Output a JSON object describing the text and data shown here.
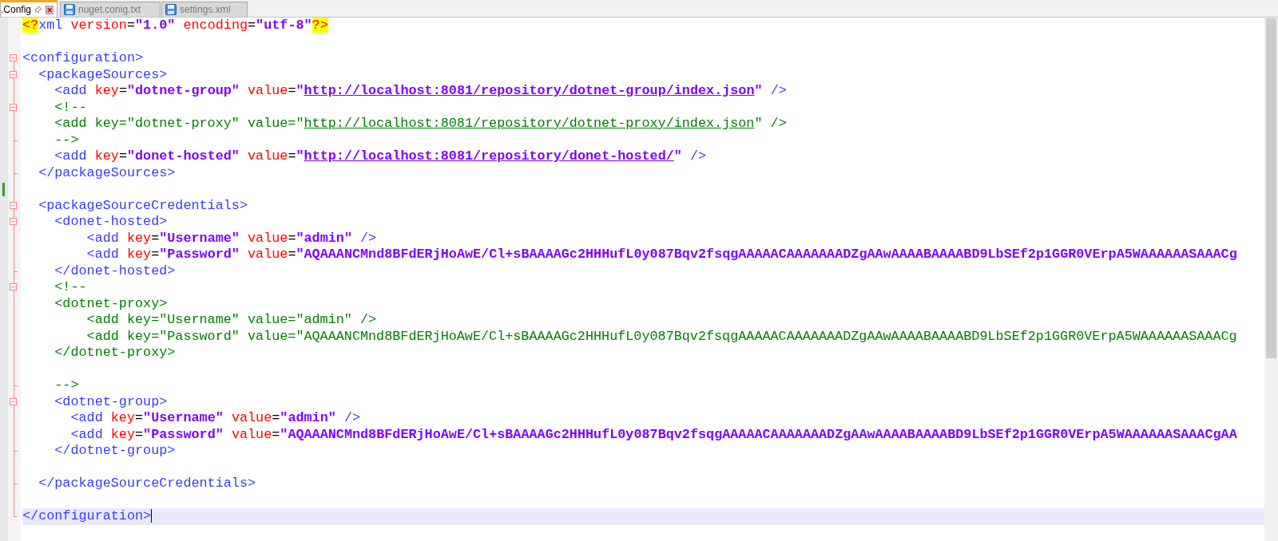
{
  "tabs": [
    {
      "label": ".Config",
      "selected": true
    },
    {
      "label": "nuget.conig.txt",
      "selected": false
    },
    {
      "label": "settings.xml",
      "selected": false
    }
  ],
  "lines": [
    {
      "kind": "none",
      "changed": false,
      "current": false,
      "tokens": [
        {
          "kind": "pi",
          "text": "<?"
        },
        {
          "kind": "tag",
          "text": "xml"
        },
        {
          "kind": "attr",
          "text": " version"
        },
        {
          "kind": "eq",
          "text": "="
        },
        {
          "kind": "str",
          "text": "\"1.0\""
        },
        {
          "kind": "attr",
          "text": " encoding"
        },
        {
          "kind": "eq",
          "text": "="
        },
        {
          "kind": "str",
          "text": "\"utf-8\""
        },
        {
          "kind": "pi",
          "text": "?>"
        }
      ]
    },
    {
      "kind": "none",
      "changed": false,
      "current": false
    },
    {
      "kind": "open",
      "changed": false,
      "current": false,
      "tokens": [
        {
          "kind": "tag",
          "text": "<configuration>"
        }
      ]
    },
    {
      "kind": "open",
      "changed": false,
      "current": false,
      "tokens": [
        {
          "kind": "tag",
          "text": "  <packageSources>"
        }
      ]
    },
    {
      "kind": "mid",
      "changed": false,
      "current": false,
      "tokens": [
        {
          "kind": "tag",
          "text": "    <add"
        },
        {
          "kind": "attr",
          "text": " key"
        },
        {
          "kind": "eq",
          "text": "="
        },
        {
          "kind": "str",
          "text": "\"dotnet-group\""
        },
        {
          "kind": "attr",
          "text": " value"
        },
        {
          "kind": "eq",
          "text": "="
        },
        {
          "kind": "str",
          "text": "\""
        },
        {
          "kind": "link",
          "text": "http://localhost:8081/repository/dotnet-group/index.json"
        },
        {
          "kind": "str",
          "text": "\""
        },
        {
          "kind": "tag",
          "text": " />"
        }
      ]
    },
    {
      "kind": "open",
      "changed": false,
      "current": false,
      "tokens": [
        {
          "kind": "comment",
          "text": "    <!--"
        }
      ]
    },
    {
      "kind": "mid",
      "changed": false,
      "current": false,
      "tokens": [
        {
          "kind": "comment",
          "text": "    <add key=\"dotnet-proxy\" value=\""
        },
        {
          "kind": "comment-link",
          "text": "http://localhost:8081/repository/dotnet-proxy/index.json"
        },
        {
          "kind": "comment",
          "text": "\" />"
        }
      ]
    },
    {
      "kind": "end",
      "changed": false,
      "current": false,
      "tokens": [
        {
          "kind": "comment",
          "text": "    -->"
        }
      ]
    },
    {
      "kind": "mid",
      "changed": false,
      "current": false,
      "tokens": [
        {
          "kind": "tag",
          "text": "    <add"
        },
        {
          "kind": "attr",
          "text": " key"
        },
        {
          "kind": "eq",
          "text": "="
        },
        {
          "kind": "str",
          "text": "\"donet-hosted\""
        },
        {
          "kind": "attr",
          "text": " value"
        },
        {
          "kind": "eq",
          "text": "="
        },
        {
          "kind": "str",
          "text": "\""
        },
        {
          "kind": "link",
          "text": "http://localhost:8081/repository/donet-hosted/"
        },
        {
          "kind": "str",
          "text": "\""
        },
        {
          "kind": "tag",
          "text": " />"
        }
      ]
    },
    {
      "kind": "end",
      "changed": false,
      "current": false,
      "tokens": [
        {
          "kind": "tag",
          "text": "  </packageSources>"
        }
      ]
    },
    {
      "kind": "mid",
      "changed": true,
      "current": false
    },
    {
      "kind": "open",
      "changed": false,
      "current": false,
      "tokens": [
        {
          "kind": "tag",
          "text": "  <packageSourceCredentials>"
        }
      ]
    },
    {
      "kind": "open",
      "changed": false,
      "current": false,
      "tokens": [
        {
          "kind": "tag",
          "text": "    <donet-hosted>"
        }
      ]
    },
    {
      "kind": "mid",
      "changed": false,
      "current": false,
      "tokens": [
        {
          "kind": "tag",
          "text": "        <add"
        },
        {
          "kind": "attr",
          "text": " key"
        },
        {
          "kind": "eq",
          "text": "="
        },
        {
          "kind": "str",
          "text": "\"Username\""
        },
        {
          "kind": "attr",
          "text": " value"
        },
        {
          "kind": "eq",
          "text": "="
        },
        {
          "kind": "str",
          "text": "\"admin\""
        },
        {
          "kind": "tag",
          "text": " />"
        }
      ]
    },
    {
      "kind": "mid",
      "changed": false,
      "current": false,
      "tokens": [
        {
          "kind": "tag",
          "text": "        <add"
        },
        {
          "kind": "attr",
          "text": " key"
        },
        {
          "kind": "eq",
          "text": "="
        },
        {
          "kind": "str",
          "text": "\"Password\""
        },
        {
          "kind": "attr",
          "text": " value"
        },
        {
          "kind": "eq",
          "text": "="
        },
        {
          "kind": "str",
          "text": "\"AQAAANCMnd8BFdERjHoAwE/Cl+sBAAAAGc2HHHufL0y087Bqv2fsqgAAAAACAAAAAAADZgAAwAAAABAAAABD9LbSEf2p1GGR0VErpA5WAAAAAASAAACg"
        }
      ]
    },
    {
      "kind": "end",
      "changed": false,
      "current": false,
      "tokens": [
        {
          "kind": "tag",
          "text": "    </donet-hosted>"
        }
      ]
    },
    {
      "kind": "open",
      "changed": false,
      "current": false,
      "tokens": [
        {
          "kind": "comment",
          "text": "    <!--"
        }
      ]
    },
    {
      "kind": "mid",
      "changed": false,
      "current": false,
      "tokens": [
        {
          "kind": "comment",
          "text": "    <dotnet-proxy>"
        }
      ]
    },
    {
      "kind": "mid",
      "changed": false,
      "current": false,
      "tokens": [
        {
          "kind": "comment",
          "text": "        <add key=\"Username\" value=\"admin\" />"
        }
      ]
    },
    {
      "kind": "mid",
      "changed": false,
      "current": false,
      "tokens": [
        {
          "kind": "comment",
          "text": "        <add key=\"Password\" value=\"AQAAANCMnd8BFdERjHoAwE/Cl+sBAAAAGc2HHHufL0y087Bqv2fsqgAAAAACAAAAAAADZgAAwAAAABAAAABD9LbSEf2p1GGR0VErpA5WAAAAAASAAACg"
        }
      ]
    },
    {
      "kind": "mid",
      "changed": false,
      "current": false,
      "tokens": [
        {
          "kind": "comment",
          "text": "    </dotnet-proxy>"
        }
      ]
    },
    {
      "kind": "mid",
      "changed": false,
      "current": false
    },
    {
      "kind": "end",
      "changed": false,
      "current": false,
      "tokens": [
        {
          "kind": "comment",
          "text": "    -->"
        }
      ]
    },
    {
      "kind": "open",
      "changed": false,
      "current": false,
      "tokens": [
        {
          "kind": "tag",
          "text": "    <dotnet-group>"
        }
      ]
    },
    {
      "kind": "mid",
      "changed": false,
      "current": false,
      "tokens": [
        {
          "kind": "tag",
          "text": "      <add"
        },
        {
          "kind": "attr",
          "text": " key"
        },
        {
          "kind": "eq",
          "text": "="
        },
        {
          "kind": "str",
          "text": "\"Username\""
        },
        {
          "kind": "attr",
          "text": " value"
        },
        {
          "kind": "eq",
          "text": "="
        },
        {
          "kind": "str",
          "text": "\"admin\""
        },
        {
          "kind": "tag",
          "text": " />"
        }
      ]
    },
    {
      "kind": "mid",
      "changed": false,
      "current": false,
      "tokens": [
        {
          "kind": "tag",
          "text": "      <add"
        },
        {
          "kind": "attr",
          "text": " key"
        },
        {
          "kind": "eq",
          "text": "="
        },
        {
          "kind": "str",
          "text": "\"Password\""
        },
        {
          "kind": "attr",
          "text": " value"
        },
        {
          "kind": "eq",
          "text": "="
        },
        {
          "kind": "str",
          "text": "\"AQAAANCMnd8BFdERjHoAwE/Cl+sBAAAAGc2HHHufL0y087Bqv2fsqgAAAAACAAAAAAADZgAAwAAAABAAAABD9LbSEf2p1GGR0VErpA5WAAAAAASAAACgAA"
        }
      ]
    },
    {
      "kind": "end",
      "changed": false,
      "current": false,
      "tokens": [
        {
          "kind": "tag",
          "text": "    </dotnet-group>"
        }
      ]
    },
    {
      "kind": "mid",
      "changed": false,
      "current": false
    },
    {
      "kind": "end",
      "changed": false,
      "current": false,
      "tokens": [
        {
          "kind": "tag",
          "text": "  </packageSourceCredentials>"
        }
      ]
    },
    {
      "kind": "mid",
      "changed": false,
      "current": false
    },
    {
      "kind": "close",
      "changed": false,
      "current": true,
      "tokens": [
        {
          "kind": "tag",
          "text": "</configuration>"
        }
      ]
    }
  ]
}
